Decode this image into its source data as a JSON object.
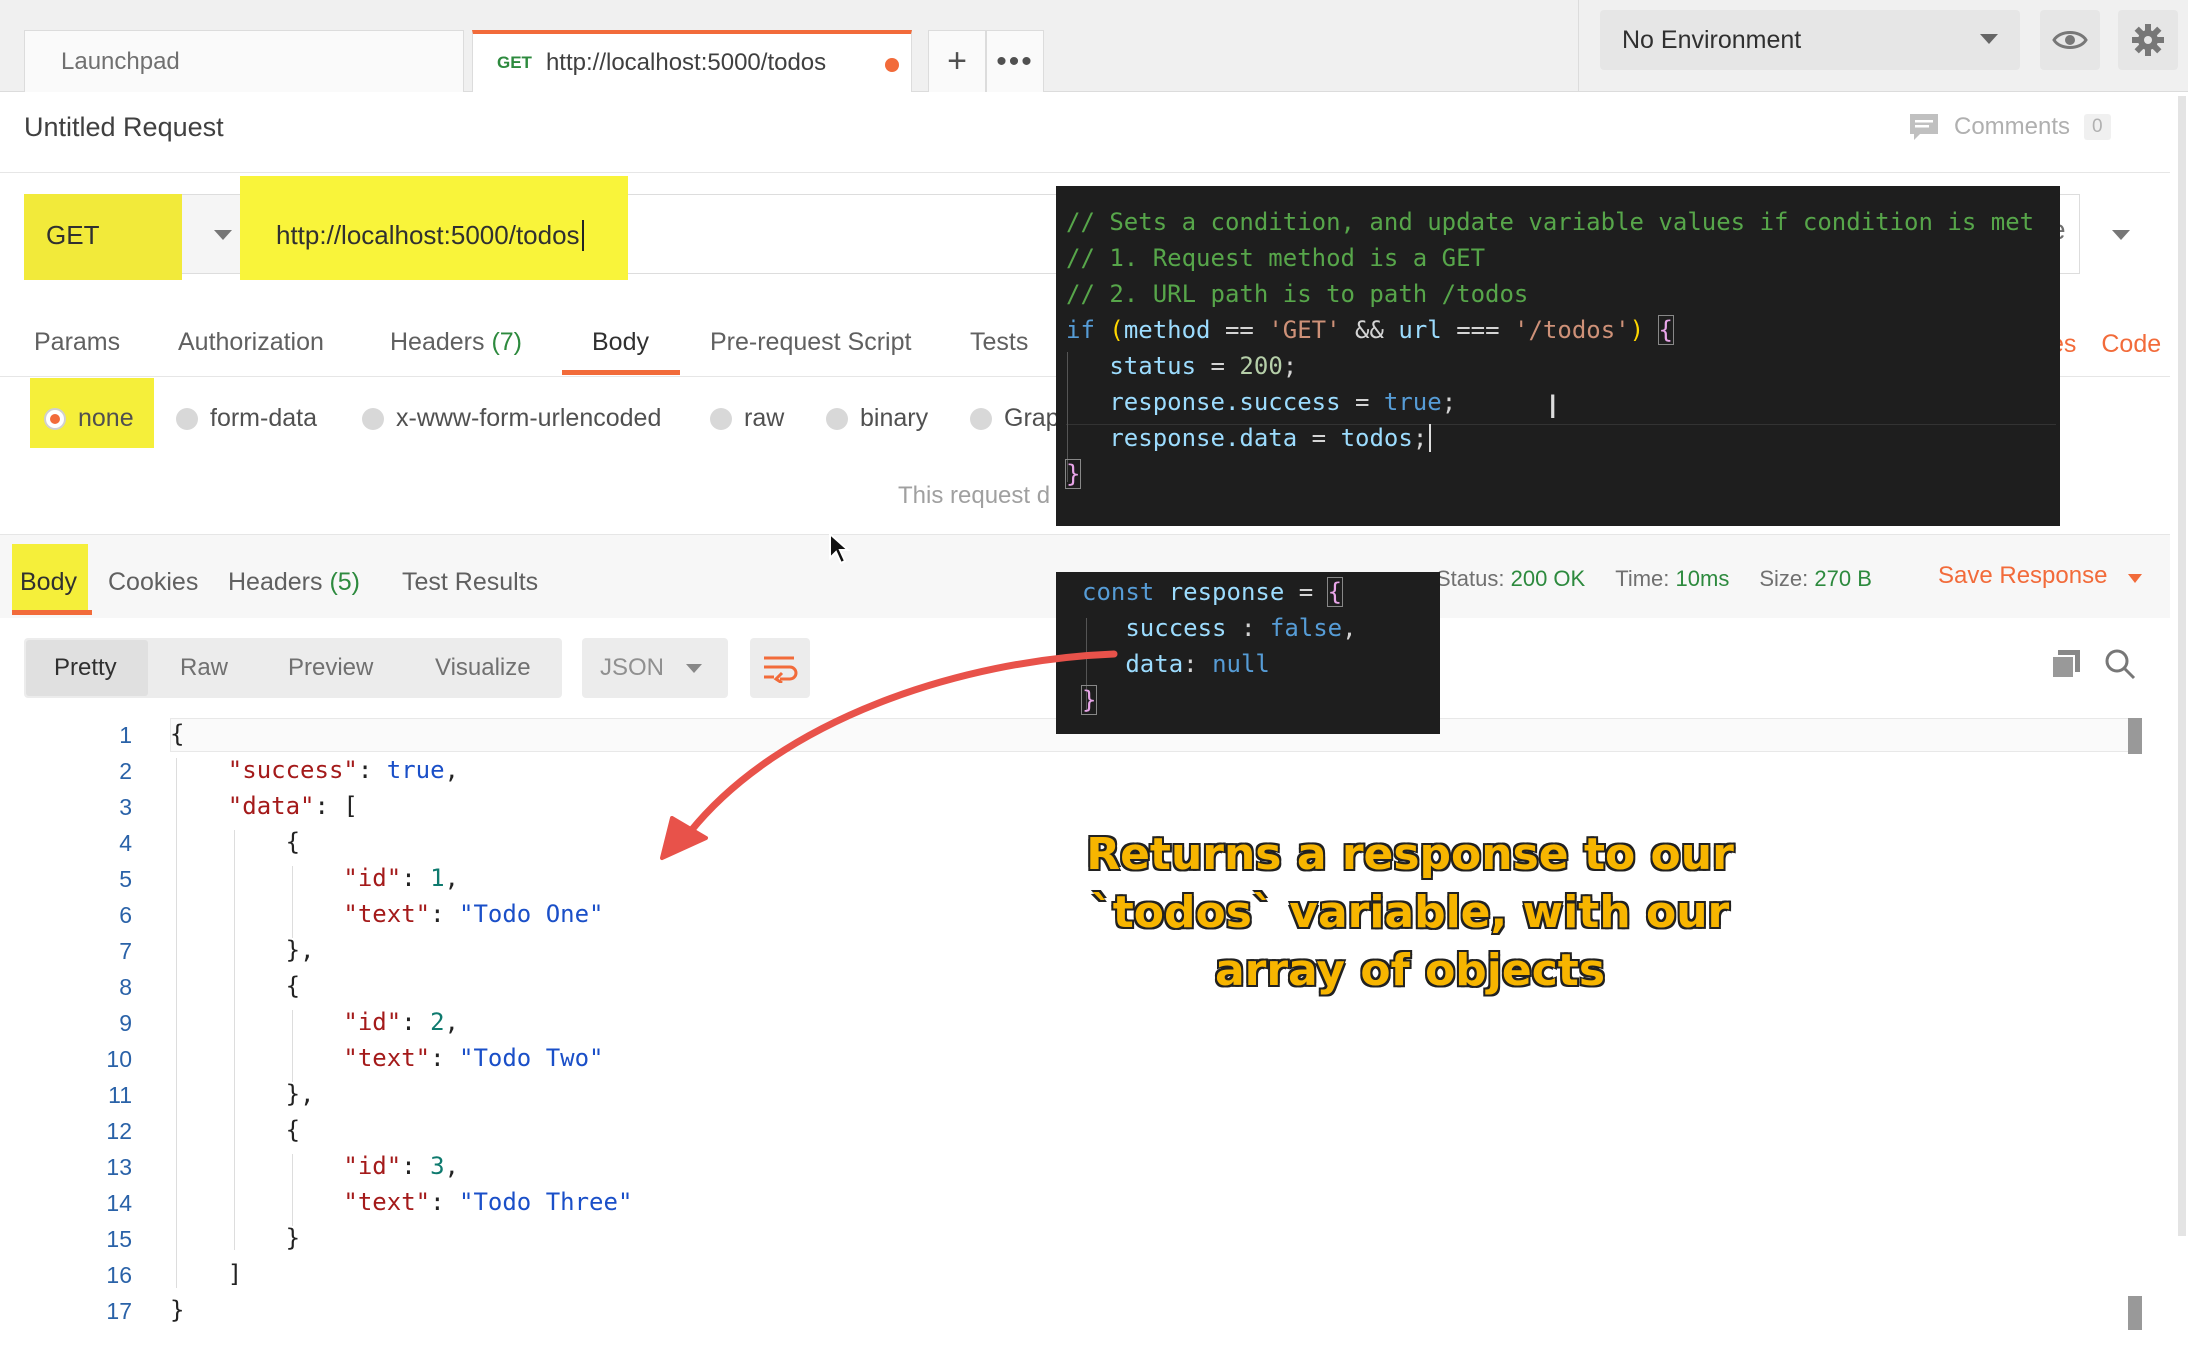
{
  "tabs": {
    "launchpad": "Launchpad",
    "active_method": "GET",
    "active_url": "http://localhost:5000/todos",
    "add_icon": "plus-icon",
    "more_icon": "more-icon"
  },
  "environment": {
    "selected": "No Environment",
    "eye_icon": "eye-icon",
    "gear_icon": "gear-icon"
  },
  "request": {
    "title": "Untitled Request",
    "comments_label": "Comments",
    "comments_count": "0",
    "method": "GET",
    "url": "http://localhost:5000/todos",
    "send_partial": "e"
  },
  "request_tabs": {
    "params": "Params",
    "authorization": "Authorization",
    "headers": "Headers",
    "headers_count": "(7)",
    "body": "Body",
    "prerequest": "Pre-request Script",
    "tests": "Tests",
    "cookies_partial": "es",
    "code": "Code"
  },
  "body_types": {
    "none": "none",
    "form_data": "form-data",
    "urlencoded": "x-www-form-urlencoded",
    "raw": "raw",
    "binary": "binary",
    "graphql_partial": "Grap",
    "no_body_text": "This request d"
  },
  "response": {
    "tabs": {
      "body": "Body",
      "cookies": "Cookies",
      "headers": "Headers",
      "headers_count": "(5)",
      "test_results": "Test Results"
    },
    "status_label": "Status:",
    "status_value": "200 OK",
    "time_label": "Time:",
    "time_value": "10ms",
    "size_label": "Size:",
    "size_value": "270 B",
    "save_label": "Save Response",
    "modes": {
      "pretty": "Pretty",
      "raw": "Raw",
      "preview": "Preview",
      "visualize": "Visualize"
    },
    "format": "JSON",
    "line_numbers": [
      "1",
      "2",
      "3",
      "4",
      "5",
      "6",
      "7",
      "8",
      "9",
      "10",
      "11",
      "12",
      "13",
      "14",
      "15",
      "16",
      "17"
    ],
    "json_text": {
      "l2_key": "\"success\"",
      "l2_val": "true",
      "l3_key": "\"data\"",
      "l5_key": "\"id\"",
      "l5_val": "1",
      "l6_key": "\"text\"",
      "l6_val": "\"Todo One\"",
      "l9_key": "\"id\"",
      "l9_val": "2",
      "l10_key": "\"text\"",
      "l10_val": "\"Todo Two\"",
      "l13_key": "\"id\"",
      "l13_val": "3",
      "l14_key": "\"text\"",
      "l14_val": "\"Todo Three\""
    }
  },
  "overlay_code_1": {
    "c1": "// Sets a condition, and update variable values if condition is met",
    "c2": "// 1. Request method is a GET",
    "c3": "// 2. URL path is to path /todos",
    "if_kw": "if",
    "method_var": "method",
    "op_eq": "==",
    "get_str": "'GET'",
    "and_op": "&&",
    "url_var": "url",
    "op_seq": "===",
    "path_str": "'/todos'",
    "status_var": "status",
    "status_val": "200",
    "success_var": "response.success",
    "success_val": "true",
    "data_var": "response.data",
    "data_val": "todos"
  },
  "overlay_code_2": {
    "const_kw": "const",
    "response_var": "response",
    "success_key": "success",
    "success_val": "false",
    "data_key": "data",
    "data_val": "null"
  },
  "annotation": {
    "line1": "Returns a response to our",
    "line2": "`todos` variable, with our",
    "line3": "array of objects"
  },
  "colors": {
    "accent": "#f26b3a",
    "highlight": "#f5ef3a",
    "status_green": "#2d8a3e",
    "annotation_text": "#f7b500",
    "arrow": "#e8524a"
  }
}
